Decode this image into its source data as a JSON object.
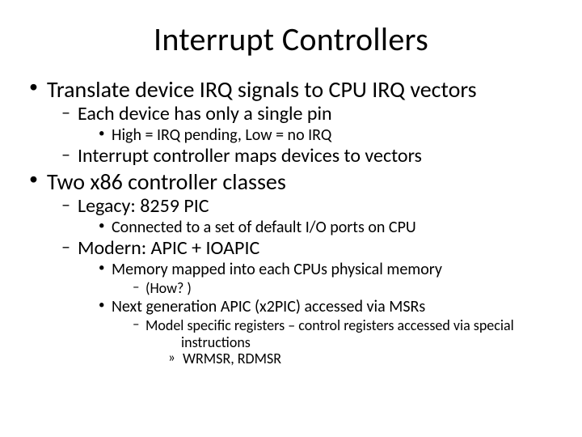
{
  "title": "Interrupt Controllers",
  "b1": {
    "text": "Translate device IRQ signals to CPU IRQ vectors",
    "sub1": {
      "text": "Each device has only a single pin",
      "sub1": "High = IRQ pending, Low = no IRQ"
    },
    "sub2": "Interrupt controller maps devices to vectors"
  },
  "b2": {
    "text": "Two x86 controller classes",
    "sub1": {
      "text": "Legacy: 8259 PIC",
      "sub1": "Connected to a set of default I/O ports on CPU"
    },
    "sub2": {
      "text": "Modern: APIC + IOAPIC",
      "sub1": {
        "text": "Memory mapped into each CPUs physical memory",
        "sub1": "(How? )"
      },
      "sub2": {
        "text": "Next generation APIC (x2PIC) accessed via MSRs",
        "sub1": {
          "text_a": "Model specific registers – control registers accessed via special",
          "text_b": "instructions",
          "sub1": "WRMSR, RDMSR"
        }
      }
    }
  }
}
